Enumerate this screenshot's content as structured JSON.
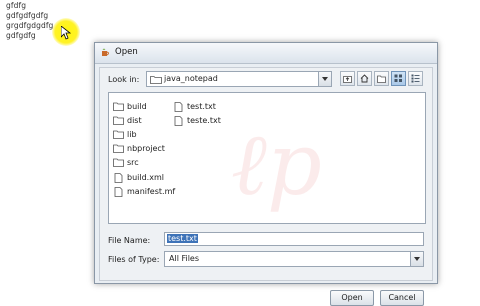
{
  "editor": {
    "lines": [
      "gfdfg",
      "gdfgdfgdfg",
      "grgdfgdgdfg",
      "gdfgdfg"
    ]
  },
  "dialog": {
    "title": "Open",
    "look_in_label": "Look in:",
    "look_in_value": "java_notepad",
    "files": [
      {
        "name": "build",
        "kind": "folder"
      },
      {
        "name": "dist",
        "kind": "folder"
      },
      {
        "name": "lib",
        "kind": "folder"
      },
      {
        "name": "nbproject",
        "kind": "folder"
      },
      {
        "name": "src",
        "kind": "folder"
      },
      {
        "name": "build.xml",
        "kind": "file"
      },
      {
        "name": "manifest.mf",
        "kind": "file"
      },
      {
        "name": "test.txt",
        "kind": "file"
      },
      {
        "name": "teste.txt",
        "kind": "file"
      }
    ],
    "file_name_label": "File Name:",
    "file_name_value": "test.txt",
    "files_of_type_label": "Files of Type:",
    "files_of_type_value": "All Files",
    "open_label": "Open",
    "cancel_label": "Cancel"
  },
  "icons": {
    "toolbar": [
      "up-one-level-icon",
      "home-icon",
      "new-folder-icon",
      "list-view-icon",
      "details-view-icon"
    ],
    "folder": "folder-icon",
    "file": "file-icon"
  },
  "colors": {
    "selection": "#3e73b8",
    "cursor_highlight": "#ffee00"
  }
}
